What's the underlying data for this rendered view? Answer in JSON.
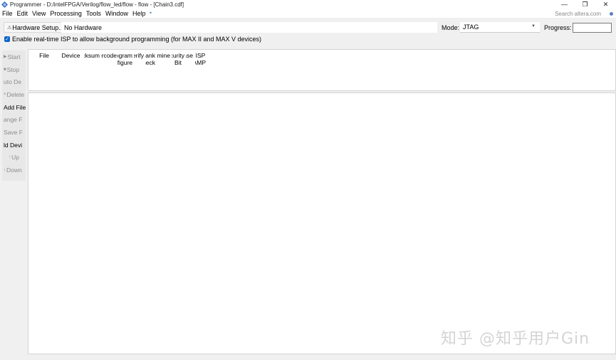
{
  "window": {
    "title": "Programmer - D:/intelFPGA/Verilog/flow_led/flow - flow - [Chain3.cdf]",
    "controls": [
      "—",
      "❐",
      "✕"
    ]
  },
  "menu": {
    "items": [
      "File",
      "Edit",
      "View",
      "Processing",
      "Tools",
      "Window",
      "Help"
    ],
    "extra": "⌖",
    "search_placeholder": "Search altera.com"
  },
  "toolbar": {
    "hardware_setup_label": "Hardware Setup...",
    "hardware_value": "No Hardware",
    "mode_label": "Mode:",
    "mode_value": "JTAG",
    "progress_label": "Progress:",
    "isp_label": "Enable real-time ISP to allow background programming (for MAX II and MAX V devices)",
    "isp_checked": true
  },
  "sidebar": {
    "buttons": [
      {
        "label": "Start",
        "icon": "▶"
      },
      {
        "label": "Stop",
        "icon": "■"
      },
      {
        "label": "uto De",
        "icon": ""
      },
      {
        "label": "Delete",
        "icon": "×"
      },
      {
        "label": "Add File",
        "icon": ""
      },
      {
        "label": "ange F",
        "icon": ""
      },
      {
        "label": "Save F",
        "icon": ""
      },
      {
        "label": "ld Devi",
        "icon": ""
      },
      {
        "label": "Up",
        "icon": "↑"
      },
      {
        "label": "Down",
        "icon": "↓"
      }
    ]
  },
  "table": {
    "columns": [
      {
        "line1": "File",
        "line2": ""
      },
      {
        "line1": "Device",
        "line2": ""
      },
      {
        "line1": "Checksum",
        "line2": ""
      },
      {
        "line1": "Usercode",
        "line2": ""
      },
      {
        "line1": "Program/",
        "line2": "Configure"
      },
      {
        "line1": "Verify",
        "line2": ""
      },
      {
        "line1": "Blank-",
        "line2": "Check"
      },
      {
        "line1": "Examine",
        "line2": ""
      },
      {
        "line1": "Security",
        "line2": "Bit"
      },
      {
        "line1": "Erase",
        "line2": ""
      },
      {
        "line1": "ISP",
        "line2": "CLAMP"
      }
    ]
  },
  "watermark": "知乎 @知乎用户Gin"
}
